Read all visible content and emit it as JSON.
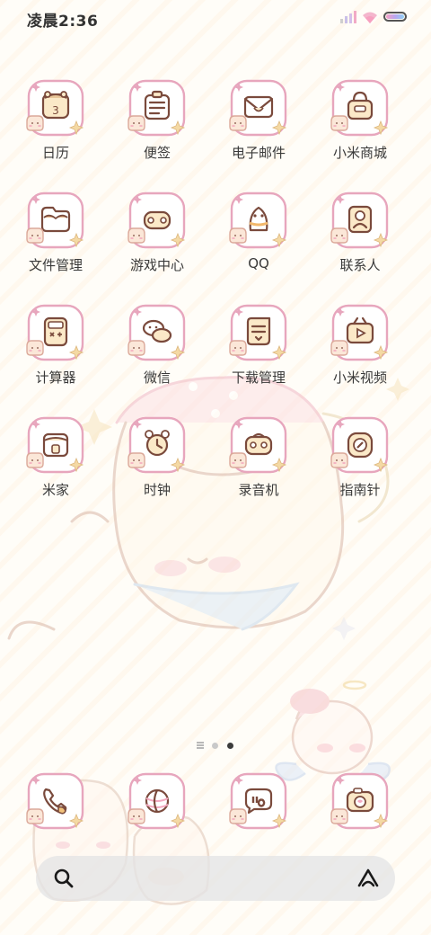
{
  "status_bar": {
    "time": "凌晨2:36"
  },
  "apps": [
    {
      "label": "日历",
      "icon": "calendar-icon",
      "day": "3"
    },
    {
      "label": "便签",
      "icon": "notes-icon"
    },
    {
      "label": "电子邮件",
      "icon": "mail-icon"
    },
    {
      "label": "小米商城",
      "icon": "shop-bag-icon"
    },
    {
      "label": "文件管理",
      "icon": "folder-icon"
    },
    {
      "label": "游戏中心",
      "icon": "gamepad-icon"
    },
    {
      "label": "QQ",
      "icon": "qq-penguin-icon"
    },
    {
      "label": "联系人",
      "icon": "contacts-icon"
    },
    {
      "label": "计算器",
      "icon": "calculator-icon"
    },
    {
      "label": "微信",
      "icon": "wechat-icon"
    },
    {
      "label": "下载管理",
      "icon": "download-scroll-icon"
    },
    {
      "label": "小米视频",
      "icon": "video-play-icon"
    },
    {
      "label": "米家",
      "icon": "mijia-house-icon"
    },
    {
      "label": "时钟",
      "icon": "alarm-clock-icon"
    },
    {
      "label": "录音机",
      "icon": "recorder-icon"
    },
    {
      "label": "指南针",
      "icon": "compass-icon"
    }
  ],
  "dock": [
    {
      "icon": "phone-icon"
    },
    {
      "icon": "browser-globe-icon"
    },
    {
      "icon": "messages-bubble-icon"
    },
    {
      "icon": "camera-icon"
    }
  ],
  "search": {
    "placeholder": ""
  },
  "colors": {
    "tile_border": "#e7a6bd",
    "icon_stroke": "#7a4a3c",
    "icon_fill": "#fbe9c8",
    "accent_pink": "#f4a9c0"
  }
}
